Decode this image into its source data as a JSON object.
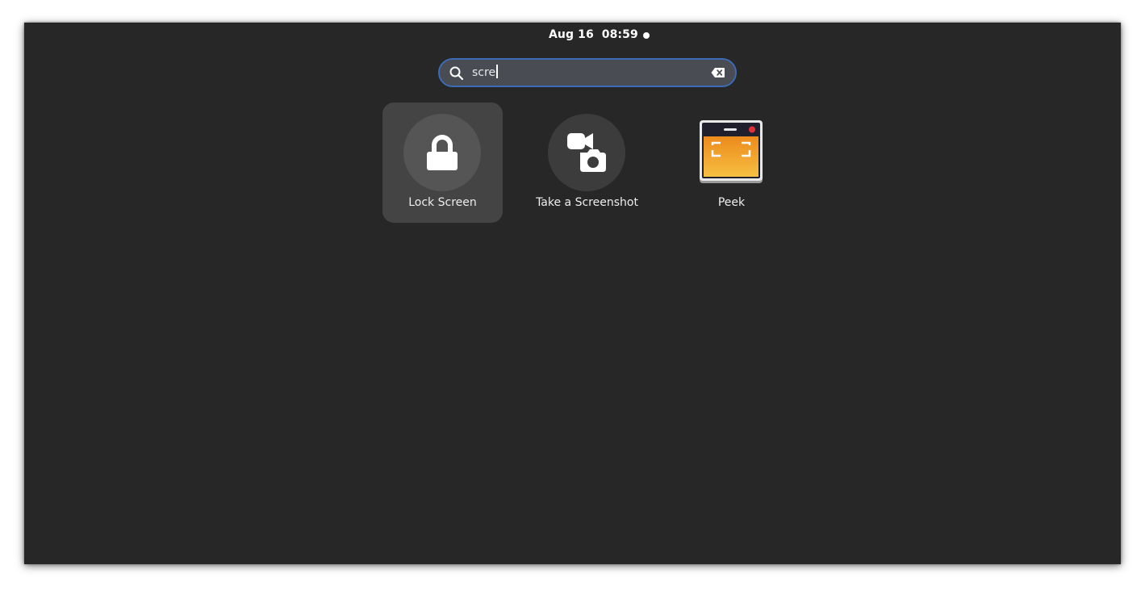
{
  "topbar": {
    "clock": "Aug 16  08:59",
    "notification_indicator": "notification-dot"
  },
  "search": {
    "value": "scre",
    "icon": "search-icon",
    "clear_icon": "clear-icon"
  },
  "results": [
    {
      "label": "Lock Screen",
      "icon": "lock-icon",
      "selected": true
    },
    {
      "label": "Take a Screenshot",
      "icon": "screenshot-icon",
      "selected": false
    },
    {
      "label": "Peek",
      "icon": "peek-app-icon",
      "selected": false
    }
  ],
  "colors": {
    "background": "#272727",
    "search_border": "#3d6ab4",
    "search_fill": "#4a4c53",
    "selected_tile": "#444444",
    "peek_orange": "#f0a030",
    "peek_record_dot": "#e0303a"
  }
}
